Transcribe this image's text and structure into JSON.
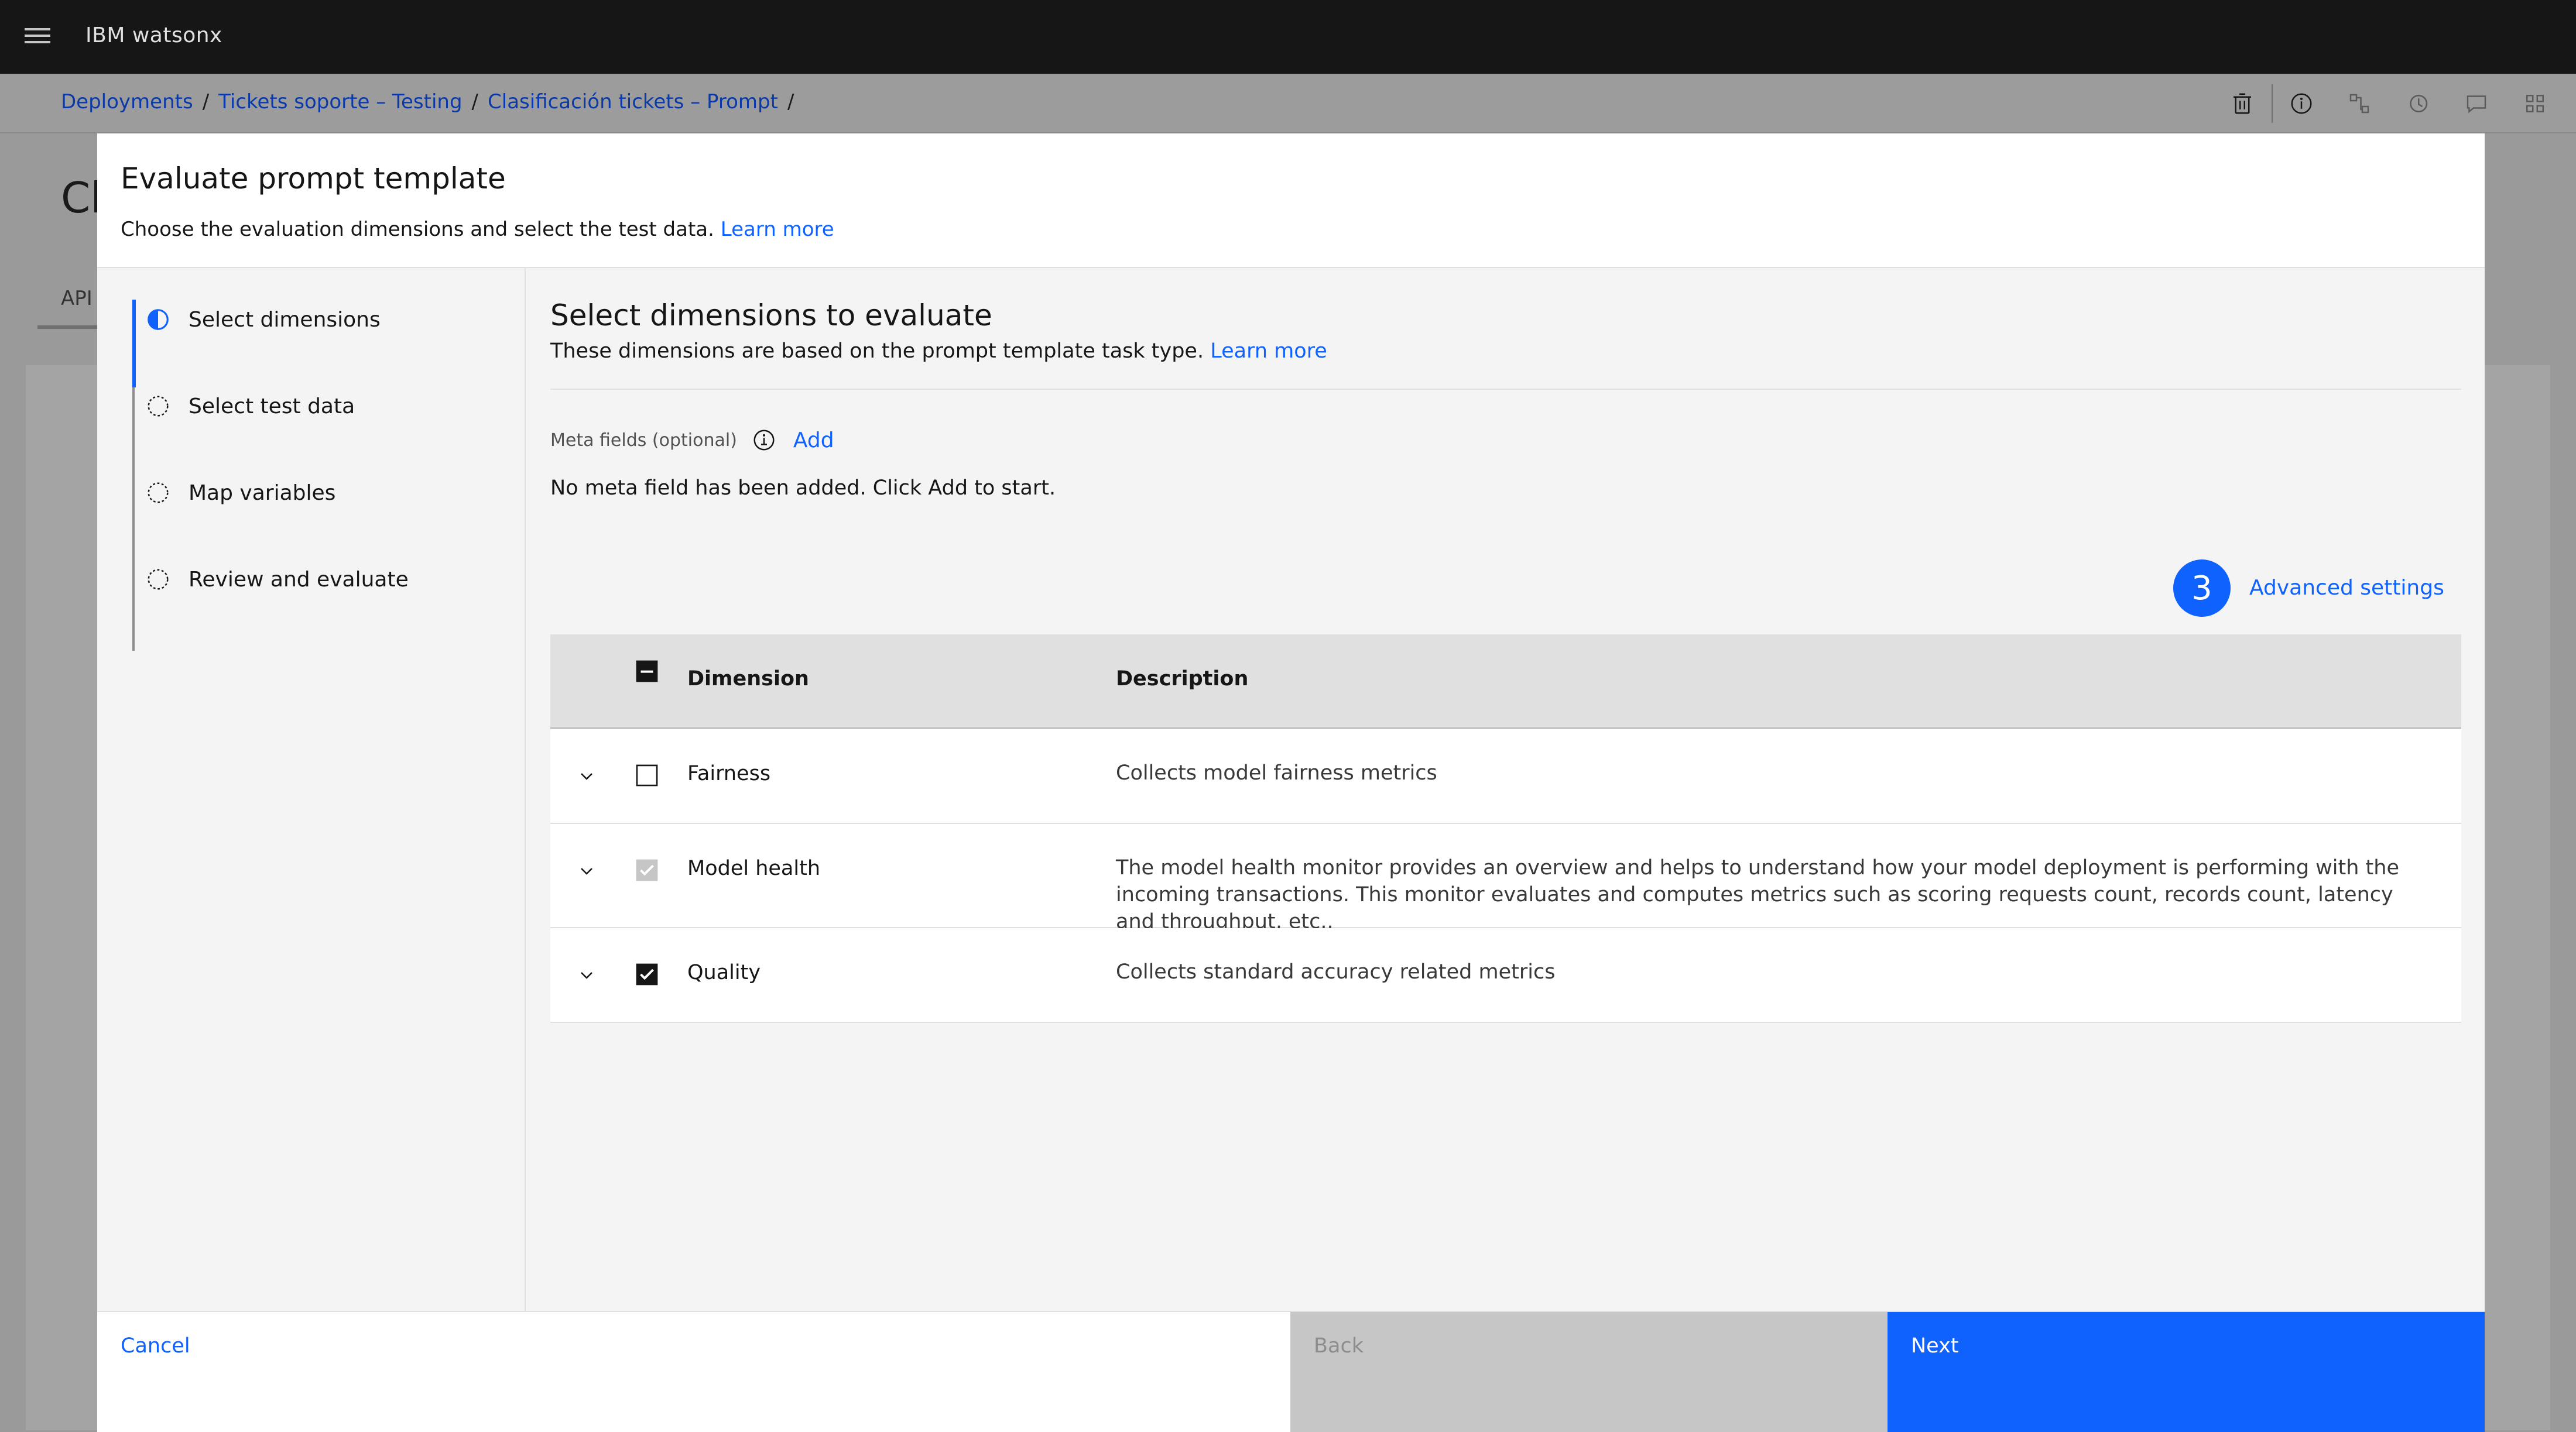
{
  "app": {
    "brand_prefix": "IBM",
    "brand_name": "watsonx"
  },
  "breadcrumb": [
    "Deployments",
    "Tickets soporte – Testing",
    "Clasificación tickets – Prompt"
  ],
  "background": {
    "title": "Cl",
    "tab": "API"
  },
  "toolbar": {
    "icons": [
      "trash-icon",
      "info-icon",
      "flow-icon",
      "history-icon",
      "chat-icon",
      "apps-icon"
    ]
  },
  "modal": {
    "title": "Evaluate prompt template",
    "subtitle": "Choose the evaluation dimensions and select the test data.",
    "subtitle_link": "Learn more"
  },
  "steps": [
    {
      "label": "Select dimensions",
      "state": "current"
    },
    {
      "label": "Select test data",
      "state": "incomplete"
    },
    {
      "label": "Map variables",
      "state": "incomplete"
    },
    {
      "label": "Review and evaluate",
      "state": "incomplete"
    }
  ],
  "content": {
    "title": "Select dimensions to evaluate",
    "subtitle": "These dimensions are based on the prompt template task type.",
    "subtitle_link": "Learn more",
    "meta_label": "Meta fields (optional)",
    "meta_add": "Add",
    "meta_empty": "No meta field has been added. Click Add to start.",
    "badge": "3",
    "advanced_settings": "Advanced settings"
  },
  "table": {
    "headers": {
      "dimension": "Dimension",
      "description": "Description"
    },
    "rows": [
      {
        "dimension": "Fairness",
        "description": "Collects model fairness metrics",
        "checked": false,
        "disabled": false
      },
      {
        "dimension": "Model health",
        "description": "The model health monitor provides an overview and helps to understand how your model deployment is performing with the incoming transactions. This monitor evaluates and computes metrics such as scoring requests count, records count, latency and throughput, etc..",
        "checked": true,
        "disabled": true
      },
      {
        "dimension": "Quality",
        "description": "Collects standard accuracy related metrics",
        "checked": true,
        "disabled": false
      }
    ]
  },
  "footer": {
    "cancel": "Cancel",
    "back": "Back",
    "next": "Next"
  },
  "colors": {
    "primary": "#0f62fe",
    "header_bg": "#161616",
    "disabled_btn": "#c6c6c6"
  }
}
